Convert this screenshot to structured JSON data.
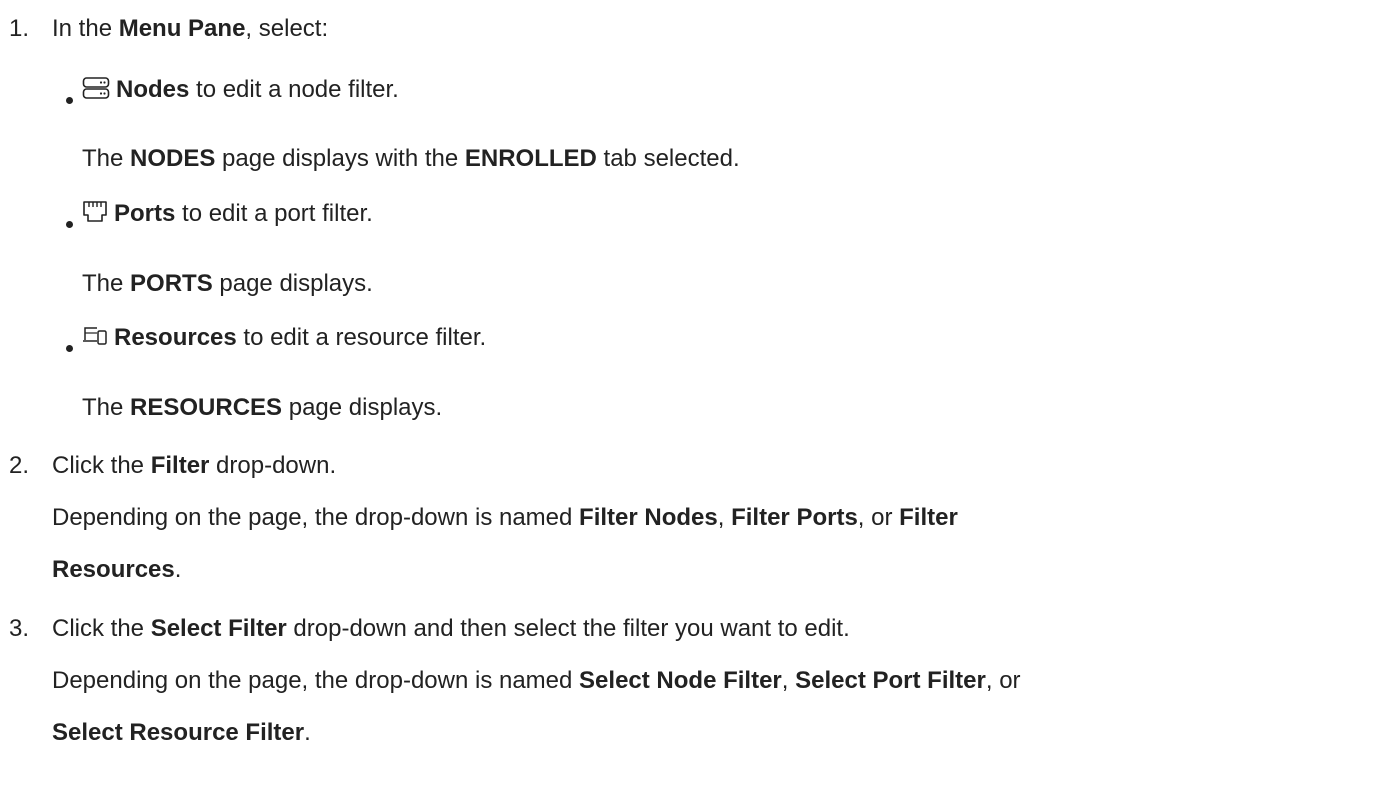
{
  "steps": [
    {
      "number": "1.",
      "text_before": "In the ",
      "bold": "Menu Pane",
      "text_after": ", select:",
      "bullets": [
        {
          "icon": "nodes-icon",
          "bold": "Nodes",
          "text": " to edit a node filter.",
          "result": {
            "pre": "The ",
            "b1": "NODES",
            "mid": " page displays with the ",
            "b2": "ENROLLED",
            "post": " tab selected."
          }
        },
        {
          "icon": "ports-icon",
          "bold": "Ports",
          "text": " to edit a port filter.",
          "result": {
            "pre": "The ",
            "b1": "PORTS",
            "post": " page displays."
          }
        },
        {
          "icon": "resources-icon",
          "bold": "Resources",
          "text": " to edit a resource filter.",
          "result": {
            "pre": "The ",
            "b1": "RESOURCES",
            "post": " page displays."
          }
        }
      ]
    },
    {
      "number": "2.",
      "pre": "Click the ",
      "bold": "Filter",
      "post": " drop-down.",
      "note": {
        "pre": "Depending on the page, the drop-down is named ",
        "b1": "Filter Nodes",
        "sep1": ", ",
        "b2": "Filter Ports",
        "sep2": ", or ",
        "b3a": "Filter",
        "b3b": "Resources",
        "end": "."
      }
    },
    {
      "number": "3.",
      "pre": "Click the ",
      "bold": "Select Filter",
      "post": " drop-down and then select the filter you want to edit.",
      "note": {
        "pre": " Depending on the page, the drop-down is named ",
        "b1": "Select Node Filter",
        "sep1": ", ",
        "b2": "Select Port Filter",
        "sep2": ", or",
        "b3": "Select Resource Filter",
        "end": "."
      }
    }
  ]
}
